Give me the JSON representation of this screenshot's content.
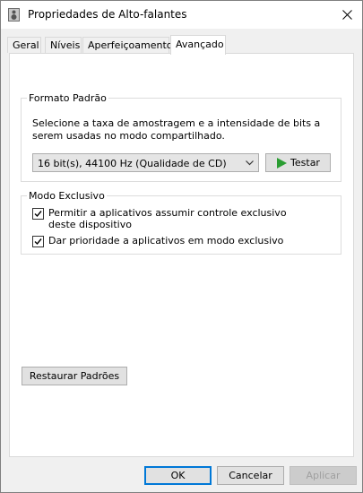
{
  "window": {
    "title": "Propriedades de Alto-falantes"
  },
  "tabs": [
    {
      "label": "Geral",
      "active": false
    },
    {
      "label": "Níveis",
      "active": false
    },
    {
      "label": "Aperfeiçoamentos",
      "active": false
    },
    {
      "label": "Avançado",
      "active": true
    }
  ],
  "default_format": {
    "legend": "Formato Padrão",
    "description": "Selecione a taxa de amostragem e a intensidade de bits a serem usadas no modo compartilhado.",
    "selected_format": "16 bit(s), 44100 Hz (Qualidade de CD)",
    "test_button": "Testar"
  },
  "exclusive_mode": {
    "legend": "Modo Exclusivo",
    "options": [
      {
        "label": "Permitir a aplicativos assumir controle exclusivo deste dispositivo",
        "checked": true
      },
      {
        "label": "Dar prioridade a aplicativos em modo exclusivo",
        "checked": true
      }
    ]
  },
  "restore_button": "Restaurar Padrões",
  "footer": {
    "ok": "OK",
    "cancel": "Cancelar",
    "apply": "Aplicar"
  },
  "colors": {
    "accent": "#0078d7",
    "play_green": "#2a9d32"
  }
}
